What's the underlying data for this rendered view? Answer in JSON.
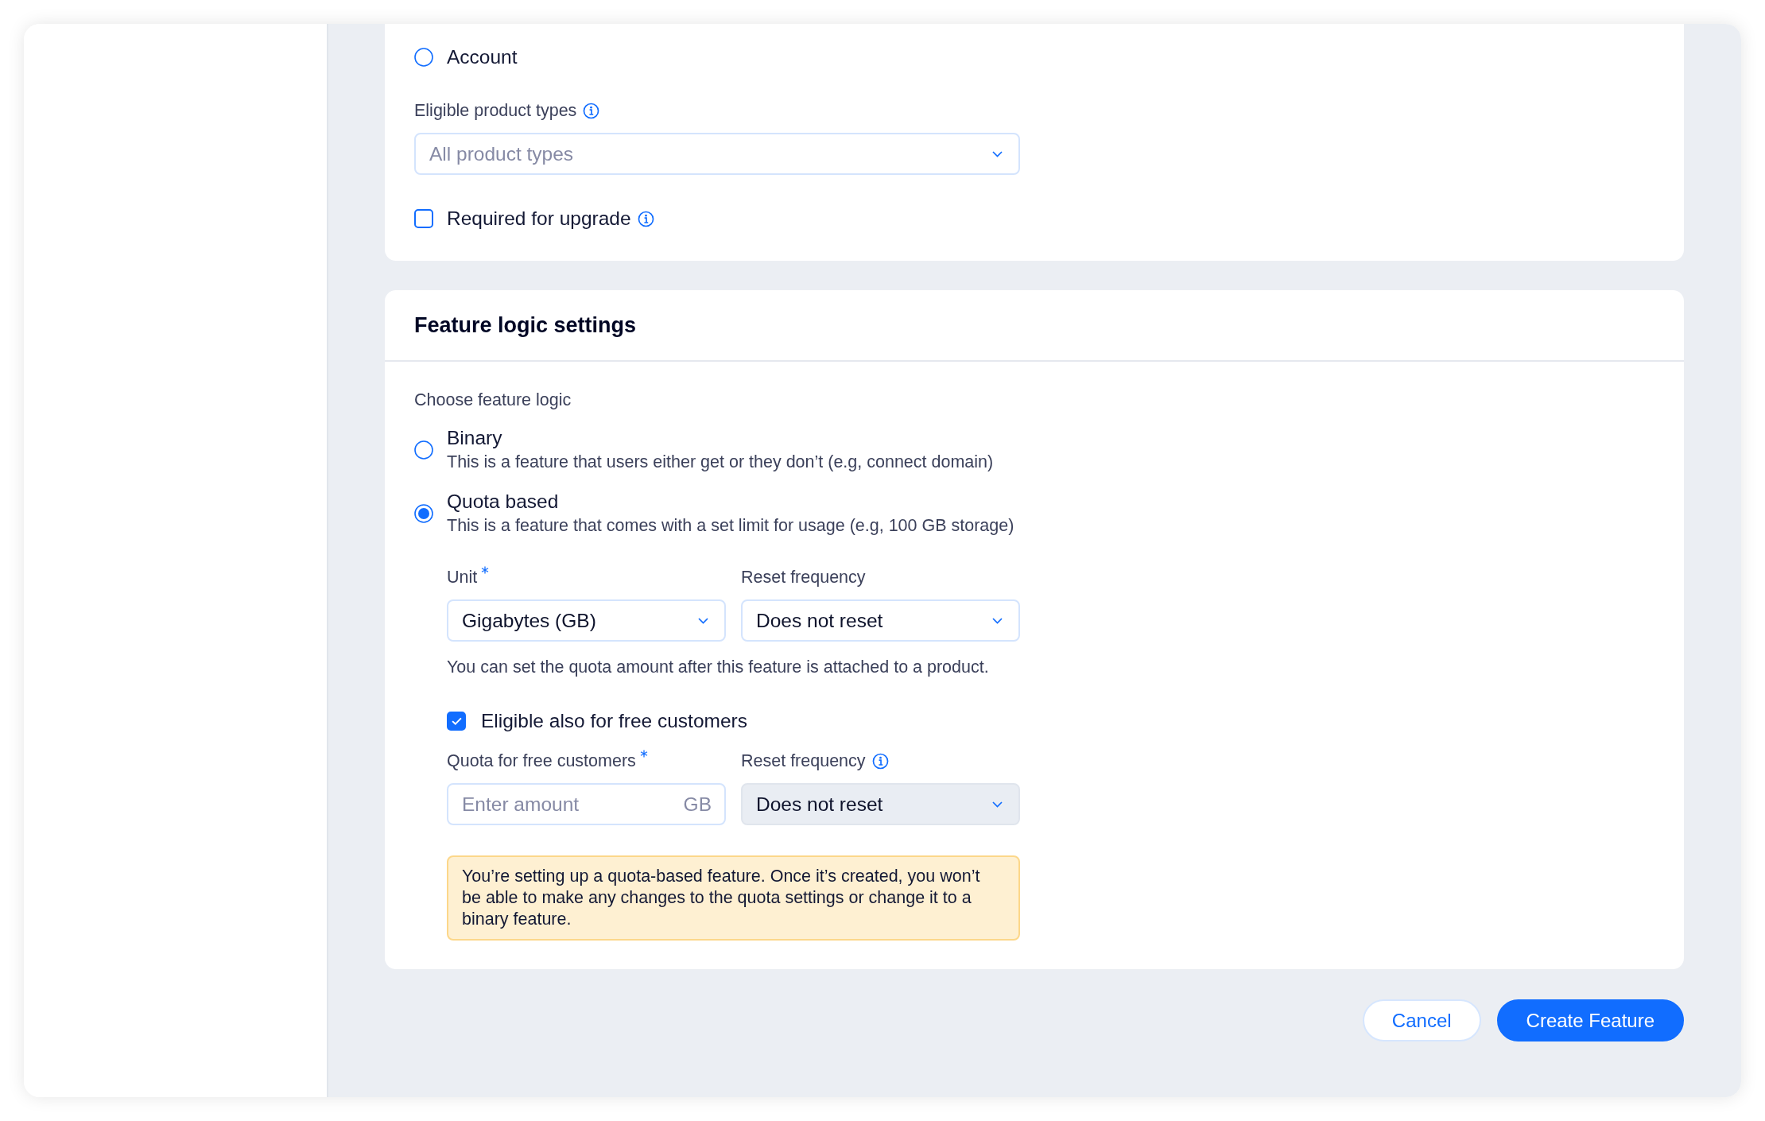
{
  "scope_options": [
    {
      "label": "Account",
      "selected": false
    }
  ],
  "product_types": {
    "label": "Eligible product types",
    "info": true,
    "placeholder": "All product types",
    "disabled": false
  },
  "required_for_upgrade": {
    "label": "Required for upgrade",
    "info": true,
    "checked": false
  },
  "logic": {
    "title": "Feature logic settings",
    "prompt": "Choose feature logic",
    "options": [
      {
        "label": "Binary",
        "description": "This is a feature that users either get or they don’t (e.g, connect domain)",
        "selected": false
      },
      {
        "label": "Quota based",
        "description": "This is a feature that comes with a set limit for usage (e.g, 100 GB storage)",
        "selected": true
      }
    ],
    "unit": {
      "label": "Unit",
      "required": true,
      "info": false,
      "value": "Gigabytes (GB)",
      "disabled": false
    },
    "reset_frequency": {
      "label": "Reset frequency",
      "required": false,
      "info": false,
      "value": "Does not reset",
      "disabled": false
    },
    "hint": "You can set the quota amount after this feature is attached to a product.",
    "free_customers": {
      "label": "Eligible also for free customers",
      "checked": true
    },
    "free_quota": {
      "label": "Quota for free customers",
      "required": true,
      "info": false,
      "placeholder": "Enter amount",
      "suffix": "GB"
    },
    "free_reset_frequency": {
      "label": "Reset frequency",
      "required": false,
      "info": true,
      "value": "Does not reset",
      "disabled": true
    },
    "warning": "You’re setting up a quota-based feature. Once it’s created, you won’t be able to make any changes to the quota settings or change it to a binary feature."
  },
  "buttons": [
    {
      "label": "Cancel",
      "kind": "secondary"
    },
    {
      "label": "Create Feature",
      "kind": "primary"
    }
  ]
}
